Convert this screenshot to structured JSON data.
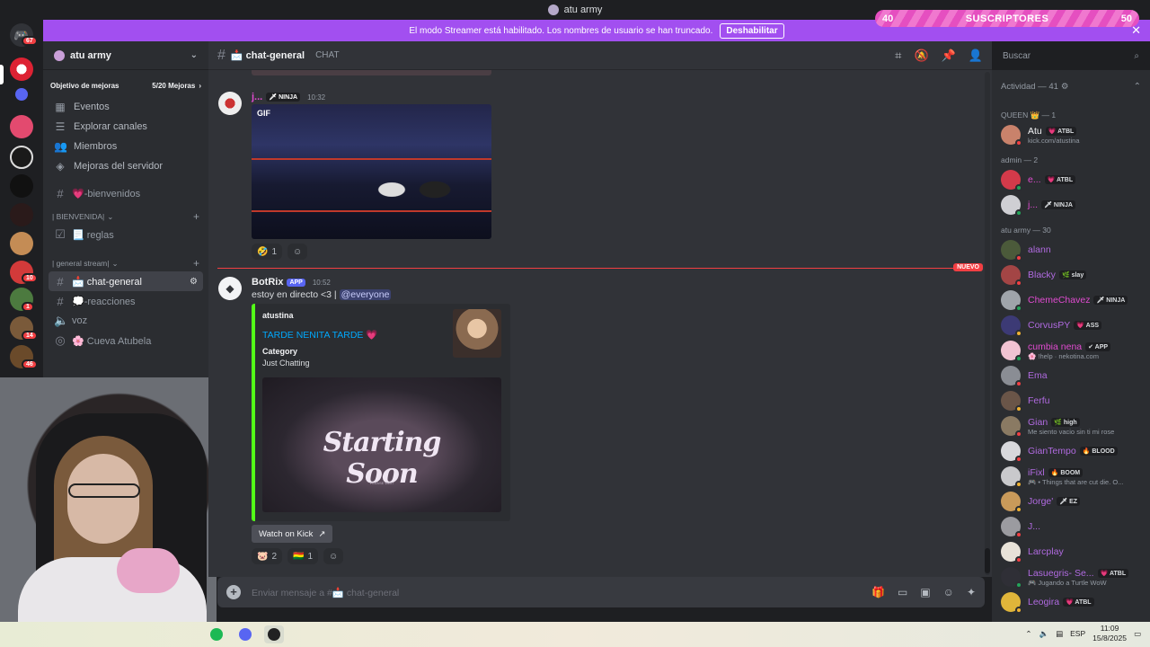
{
  "window": {
    "title": "atu army"
  },
  "overlay": {
    "left_count": "40",
    "label": "SUSCRIPTORES",
    "right_count": "50"
  },
  "banner": {
    "text": "El modo Streamer está habilitado. Los nombres de usuario se han truncado.",
    "button": "Deshabilitar"
  },
  "rail": {
    "home_badge": "67",
    "badges": [
      "10",
      "1",
      "14",
      "46"
    ]
  },
  "server": {
    "name": "atu army",
    "boost_label": "Objetivo de mejoras",
    "boost_progress": "5/20 Mejoras",
    "nav": [
      "Eventos",
      "Explorar canales",
      "Miembros",
      "Mejoras del servidor"
    ],
    "welcome_channel": "💗-bienvenidos",
    "categories": [
      {
        "name": "| BIENVENIDA|",
        "channels": [
          "📃 reglas"
        ]
      },
      {
        "name": "| general stream|",
        "channels": [
          "📩 chat-general",
          "💭-reacciones",
          "voz",
          "🌸 Cueva Atubela"
        ]
      }
    ]
  },
  "chat": {
    "channel": "📩 chat-general",
    "topic": "CHAT",
    "search_placeholder": "Buscar",
    "msg1": {
      "author": "j...",
      "role_tag": "🗡 NINJA",
      "time": "10:32",
      "gif_label": "GIF",
      "reactions": [
        {
          "emoji": "🤣",
          "count": "1"
        }
      ]
    },
    "new_marker": "NUEVO",
    "msg2": {
      "author": "BotRix",
      "app_tag": "APP",
      "time": "10:52",
      "text": "estoy en directo <3 | ",
      "mention": "@everyone",
      "embed": {
        "provider": "atustina",
        "title": "TARDE NENITA TARDE 💗",
        "field_name": "Category",
        "field_value": "Just Chatting",
        "image_text": "Starting Soon",
        "image_sub": "PLEASE WAIT"
      },
      "button": "Watch on Kick",
      "reactions": [
        {
          "emoji": "🐷",
          "count": "2"
        },
        {
          "emoji": "🇧🇴",
          "count": "1"
        }
      ]
    },
    "composer_placeholder": "Enviar mensaje a #📩 chat-general"
  },
  "members": {
    "activity": "Actividad — 41",
    "groups": [
      {
        "title": "QUEEN 👑 — 1",
        "items": [
          {
            "name": "Atu",
            "tag": "💗 ATBL",
            "status": "kick.com/atustina",
            "color": "#f2f3f5",
            "av": "#c9826b",
            "dot": "#f23f43"
          }
        ]
      },
      {
        "title": "admin — 2",
        "items": [
          {
            "name": "e...",
            "tag": "💗 ATBL",
            "status": "",
            "color": "#e04bd0",
            "av": "#d33a4a",
            "dot": "#23a55a"
          },
          {
            "name": "j...",
            "tag": "🗡 NINJA",
            "status": "",
            "color": "#e04bd0",
            "av": "#cfcfd4",
            "dot": "#23a55a"
          }
        ]
      },
      {
        "title": "atu army — 30",
        "items": [
          {
            "name": "alann",
            "tag": "",
            "status": "",
            "color": "#b06ae0",
            "av": "#4b5a3a",
            "dot": "#f23f43"
          },
          {
            "name": "Blacky",
            "tag": "🌿 slay",
            "status": "",
            "color": "#b06ae0",
            "av": "#a34545",
            "dot": "#f23f43"
          },
          {
            "name": "ChemeChavez",
            "tag": "🗡 NINJA",
            "status": "",
            "color": "#e04bd0",
            "av": "#9fa4aa",
            "dot": "#23a55a"
          },
          {
            "name": "CorvusPY",
            "tag": "💗 ASS",
            "status": "",
            "color": "#b06ae0",
            "av": "#3c3a75",
            "dot": "#f0b232"
          },
          {
            "name": "cumbia nena",
            "tag": "✔ APP",
            "status": "🌸 !help · nekotina.com",
            "color": "#e04bd0",
            "av": "#f1c3d2",
            "dot": "#23a55a"
          },
          {
            "name": "Ema",
            "tag": "",
            "status": "",
            "color": "#b06ae0",
            "av": "#8a8d94",
            "dot": "#f23f43"
          },
          {
            "name": "Ferfu",
            "tag": "",
            "status": "",
            "color": "#b06ae0",
            "av": "#6a5548",
            "dot": "#f0b232"
          },
          {
            "name": "Gian",
            "tag": "🌿 high",
            "status": "Me siento vacio sin ti mi rose",
            "color": "#b06ae0",
            "av": "#8a7a63",
            "dot": "#f23f43"
          },
          {
            "name": "GianTempo",
            "tag": "🔥 BLOOD",
            "status": "",
            "color": "#b06ae0",
            "av": "#d8d8dc",
            "dot": "#f23f43"
          },
          {
            "name": "iFixl",
            "tag": "🔥 BOOM",
            "status": "🎮 • Things that are cut die. O...",
            "color": "#b06ae0",
            "av": "#c9c9cc",
            "dot": "#f0b232"
          },
          {
            "name": "Jorge'",
            "tag": "🗡 EZ",
            "status": "",
            "color": "#b06ae0",
            "av": "#c99a5a",
            "dot": "#f0b232"
          },
          {
            "name": "J...",
            "tag": "",
            "status": "",
            "color": "#b06ae0",
            "av": "#9b9ba0",
            "dot": "#f23f43"
          },
          {
            "name": "Larcplay",
            "tag": "",
            "status": "",
            "color": "#b06ae0",
            "av": "#e8e2d8",
            "dot": "#f23f43"
          },
          {
            "name": "Lasuegris- Se...",
            "tag": "💗 ATBL",
            "status": "🎮 Jugando a Turtle WoW",
            "color": "#b06ae0",
            "av": "#2f2f36",
            "dot": "#23a55a"
          },
          {
            "name": "Leogira",
            "tag": "💗 ATBL",
            "status": "",
            "color": "#b06ae0",
            "av": "#e0b53a",
            "dot": "#f0b232"
          }
        ]
      }
    ]
  },
  "taskbar": {
    "lang": "ESP",
    "time": "11:09",
    "date": "15/8/2025"
  }
}
